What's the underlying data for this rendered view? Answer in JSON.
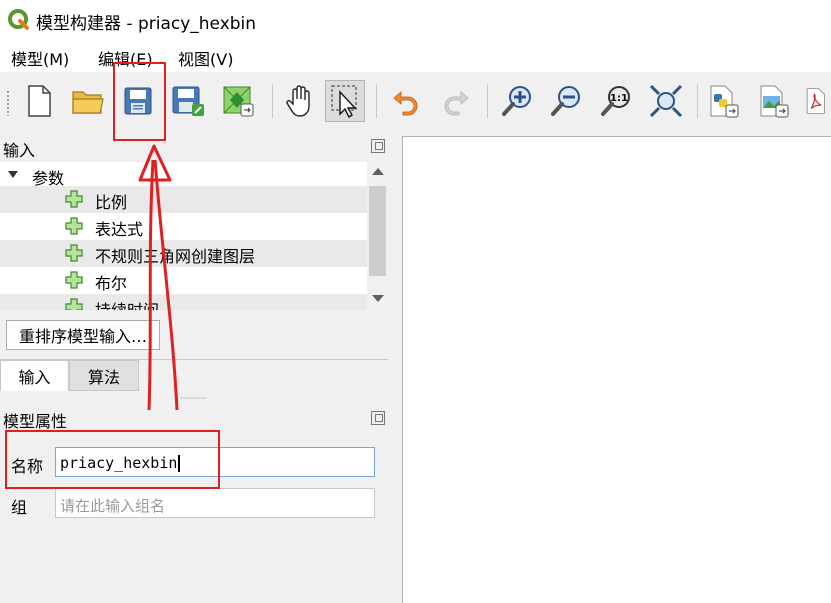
{
  "window": {
    "title": "模型构建器 - priacy_hexbin"
  },
  "menu": {
    "items": [
      {
        "label": "模型(M)"
      },
      {
        "label": "编辑(E)"
      },
      {
        "label": "视图(V)"
      }
    ]
  },
  "toolbar": {
    "buttons": [
      {
        "icon": "new-file-icon"
      },
      {
        "icon": "open-folder-icon"
      },
      {
        "icon": "save-icon"
      },
      {
        "icon": "save-as-icon"
      },
      {
        "icon": "export-image-icon"
      },
      {
        "icon": "pan-hand-icon"
      },
      {
        "icon": "select-cursor-icon"
      },
      {
        "icon": "undo-icon"
      },
      {
        "icon": "redo-icon"
      },
      {
        "icon": "zoom-in-icon"
      },
      {
        "icon": "zoom-out-icon"
      },
      {
        "icon": "zoom-actual-icon"
      },
      {
        "icon": "zoom-full-icon"
      },
      {
        "icon": "export-python-icon"
      },
      {
        "icon": "export-image-file-icon"
      },
      {
        "icon": "export-pdf-icon"
      }
    ]
  },
  "inputs_panel": {
    "title": "输入",
    "tree": {
      "group_label": "参数",
      "items": [
        {
          "label": "比例"
        },
        {
          "label": "表达式"
        },
        {
          "label": "不规则三角网创建图层"
        },
        {
          "label": "布尔"
        },
        {
          "label": "持续时间"
        }
      ]
    },
    "reorder_button": "重排序模型输入…",
    "tabs": [
      {
        "label": "输入"
      },
      {
        "label": "算法"
      }
    ]
  },
  "model_properties": {
    "title": "模型属性",
    "name_label": "名称",
    "name_value": "priacy_hexbin",
    "group_label": "组",
    "group_placeholder": "请在此输入组名"
  },
  "colors": {
    "annotation_red": "#e02020",
    "accent_green": "#3ea53e",
    "accent_blue": "#4a78b5"
  }
}
